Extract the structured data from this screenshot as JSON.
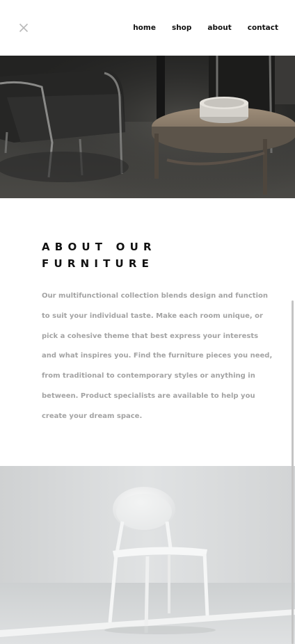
{
  "header": {
    "nav": [
      {
        "label": "home"
      },
      {
        "label": "shop"
      },
      {
        "label": "about"
      },
      {
        "label": "contact"
      }
    ]
  },
  "about": {
    "title_lines": [
      "ABOUT OUR",
      "FURNITURE"
    ],
    "body_lines": [
      "Our multifunctional collection blends design and function",
      "to suit your individual taste. Make each room unique, or",
      "pick a cohesive theme that best express your interests",
      "and what inspires you. Find the furniture pieces you need,",
      "from traditional to contemporary styles or anything in",
      "between. Product specialists are available to help you",
      "create your dream space."
    ]
  },
  "colors": {
    "text_dark": "#111111",
    "text_muted": "#a3a3a3",
    "hero_bg": "#2b2b2a",
    "chair_bg": "#d9dbdc"
  },
  "icons": {
    "close": "close-icon"
  }
}
